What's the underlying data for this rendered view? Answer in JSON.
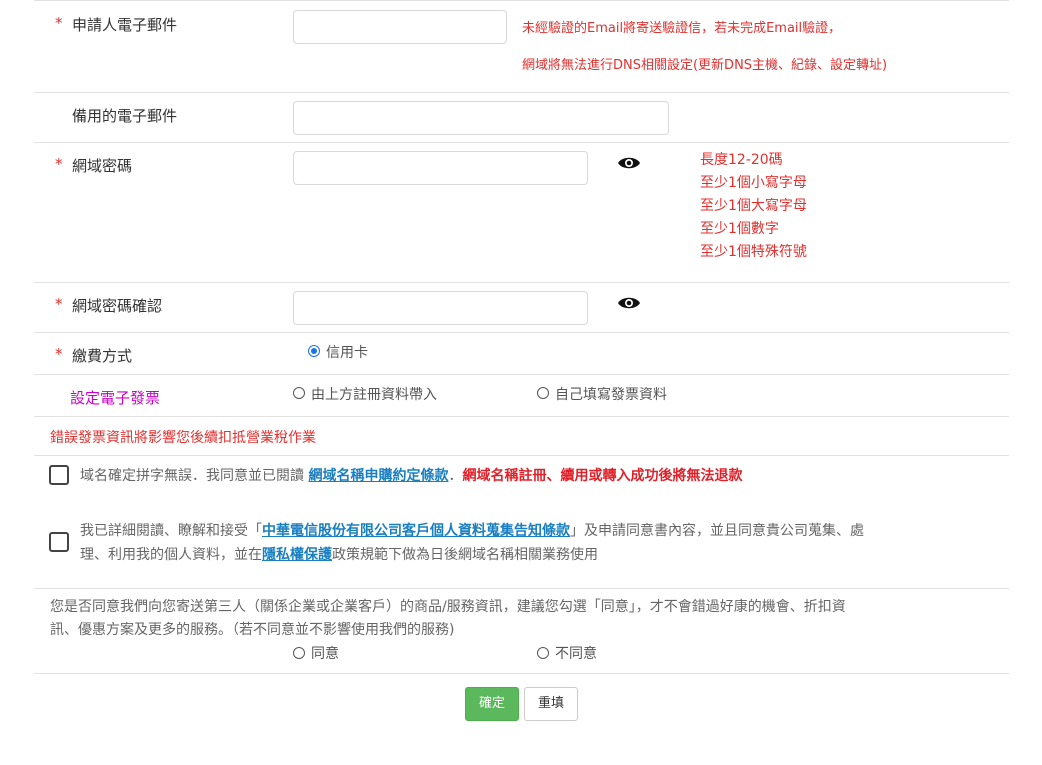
{
  "form": {
    "email": {
      "required_mark": "*",
      "label": "申請人電子郵件",
      "note_line1": "未經驗證的Email將寄送驗證信，若未完成Email驗證，",
      "note_line2": "網域將無法進行DNS相關設定(更新DNS主機、紀錄、設定轉址)"
    },
    "backup_email": {
      "label": "備用的電子郵件"
    },
    "password": {
      "required_mark": "*",
      "label": "網域密碼",
      "rules": [
        "長度12-20碼",
        "至少1個小寫字母",
        "至少1個大寫字母",
        "至少1個數字",
        "至少1個特殊符號"
      ]
    },
    "password_confirm": {
      "required_mark": "*",
      "label": "網域密碼確認"
    },
    "payment": {
      "required_mark": "*",
      "label": "繳費方式",
      "option_credit_card": "信用卡"
    },
    "invoice": {
      "label": "設定電子發票",
      "option_from_registration": "由上方註冊資料帶入",
      "option_manual": "自己填寫發票資料",
      "warning": "錯誤發票資訊將影響您後續扣抵營業稅作業"
    },
    "agree_terms": {
      "text_before": "域名確定拼字無誤．我同意並已閱讀",
      "link": "網域名稱申購約定條款",
      "sep": "．",
      "warning": "網域名稱註冊、續用或轉入成功後將無法退款"
    },
    "agree_privacy": {
      "line1_before": "我已詳細閱讀、瞭解和接受「",
      "link1": "中華電信股份有限公司客戶個人資料蒐集告知條款",
      "line1_after": "」及申請同意書內容，並且同意貴公司蒐集、處",
      "line2_before": "理、利用我的個人資料，並在",
      "link2": "隱私權保護",
      "line2_after": "政策規範下做為日後網域名稱相關業務使用"
    },
    "marketing": {
      "line1": "您是否同意我們向您寄送第三人（關係企業或企業客戶）的商品/服務資訊，建議您勾選「同意」，才不會錯過好康的機會、折扣資",
      "line2": "訊、優惠方案及更多的服務。（若不同意並不影響使用我們的服務)",
      "option_agree": "同意",
      "option_disagree": "不同意"
    },
    "buttons": {
      "submit": "確定",
      "reset": "重填"
    }
  },
  "colors": {
    "required": "#e0312f",
    "invoice_label": "#cc00cc",
    "link": "#1a7fc1",
    "submit_bg": "#5cb85c"
  },
  "icons": {
    "password_toggle": "eye-icon"
  }
}
